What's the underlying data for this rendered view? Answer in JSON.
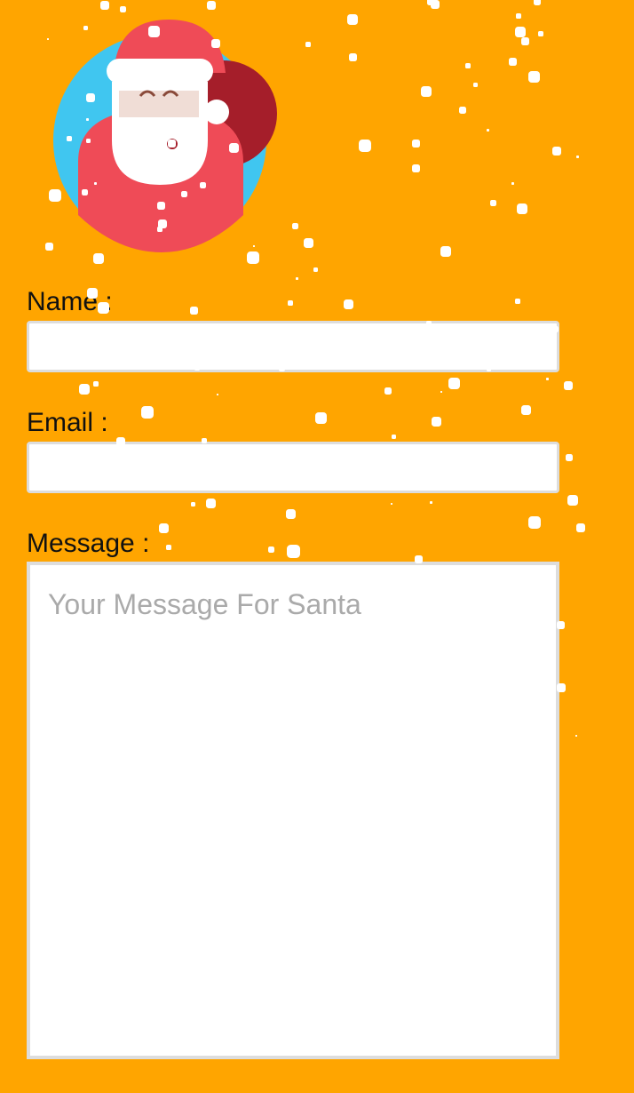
{
  "colors": {
    "background": "#ffa500",
    "santa_body": "#ef4b57",
    "santa_sack": "#a51e2a",
    "santa_circle": "#40c6f0",
    "beard": "#ffffff",
    "face": "#f0ddd6",
    "snow": "#ffffff",
    "field_border": "#dddddd"
  },
  "illustration": {
    "icon": "santa-claus-icon"
  },
  "form": {
    "name": {
      "label": "Name :",
      "value": ""
    },
    "email": {
      "label": "Email :",
      "value": ""
    },
    "message": {
      "label": "Message :",
      "value": "",
      "placeholder": "Your Message For Santa"
    }
  }
}
